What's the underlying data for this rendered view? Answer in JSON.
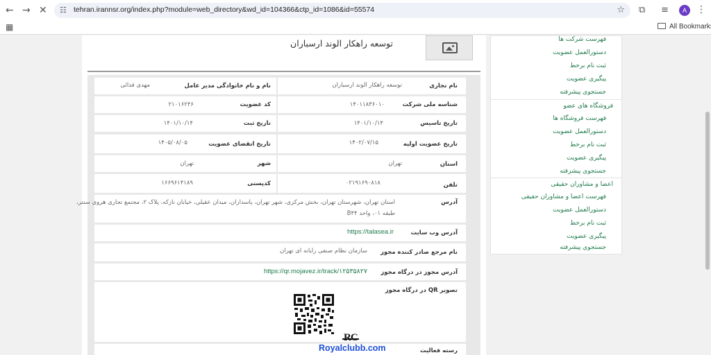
{
  "browser": {
    "url": "tehran.irannsr.org/index.php?module=web_directory&wd_id=104366&ctp_id=1086&id=55574",
    "back_icon": "back-arrow-icon",
    "forward_icon": "forward-arrow-icon",
    "stop_icon": "close-icon",
    "avatar_letter": "A",
    "all_bookmarks": "All Bookmarks"
  },
  "company": {
    "title": "توسعه راهکار الوند ارسباران"
  },
  "details": {
    "trade_name_label": "نام تجاری",
    "trade_name_value": "توسعه راهکار الوند ارسباران",
    "ceo_label": "نام و نام خانوادگی مدیر عامل",
    "ceo_value": "مهدی فدائی",
    "national_id_label": "شناسه ملی شرکت",
    "national_id_value": "۱۴۰۱۱۸۳۶۰۱۰",
    "member_code_label": "کد عضویت",
    "member_code_value": "۲۱۰۱۶۲۴۶",
    "founding_date_label": "تاریخ تاسیس",
    "founding_date_value": "۱۴۰۱/۱۰/۱۴",
    "register_date_label": "تاریخ ثبت",
    "register_date_value": "۱۴۰۱/۱۰/۱۴",
    "first_membership_label": "تاریخ عضویت اولیه",
    "first_membership_value": "۱۴۰۲/۰۷/۱۵",
    "membership_expiry_label": "تاریخ انقضای عضویت",
    "membership_expiry_value": "۱۴۰۵/۰۸/۰۵",
    "province_label": "استان",
    "province_value": "تهران",
    "city_label": "شهر",
    "city_value": "تهران",
    "phone_label": "تلفن",
    "phone_value": "۰۲۱۹۱۶۹۰۸۱۸",
    "postal_code_label": "کدپستی",
    "postal_code_value": "۱۶۶۹۶۱۴۱۸۹",
    "address_label": "آدرس",
    "address_line1": "استان تهران، شهرستان تهران، بخش مرکزی، شهر تهران، پاسداران، میدان عقیلی، خیابان نازکه، پلاک ۲، مجتمع تجاری هروی سنتر،",
    "address_line2": "طبقه ۰۱، واحد B۴۴",
    "website_label": "آدرس وب سایت",
    "website_value": "https://talasea.ir",
    "license_issuer_label": "نام مرجع صادر کننده مجوز",
    "license_issuer_value": "سازمان نظام صنفی رایانه ای تهران",
    "license_url_label": "آدرس مجوز در درگاه مجوز",
    "license_url_value": "https://qr.mojavez.ir/track/۱۲۵۳۵۸۲۷",
    "qr_label": "تصویر QR در درگاه مجوز",
    "activity_label": "رسته فعالیت"
  },
  "sidebar": {
    "items": [
      {
        "label": "فهرست شرکت ها",
        "type": "sub"
      },
      {
        "label": "دستورالعمل عضویت",
        "type": "sub"
      },
      {
        "label": "ثبت نام برخط",
        "type": "sub"
      },
      {
        "label": "پیگیری عضویت",
        "type": "sub"
      },
      {
        "label": "جستجوی پیشرفته",
        "type": "sub"
      },
      {
        "label": "فروشگاه های عضو",
        "type": "section"
      },
      {
        "label": "فهرست فروشگاه ها",
        "type": "sub"
      },
      {
        "label": "دستورالعمل عضویت",
        "type": "sub"
      },
      {
        "label": "ثبت نام برخط",
        "type": "sub"
      },
      {
        "label": "پیگیری عضویت",
        "type": "sub"
      },
      {
        "label": "جستجوی پیشرفته",
        "type": "sub"
      },
      {
        "label": "اعضا و مشاوران حقیقی",
        "type": "section"
      },
      {
        "label": "فهرست اعضا و مشاوران حقیقی",
        "type": "sub"
      },
      {
        "label": "دستورالعمل عضویت",
        "type": "sub"
      },
      {
        "label": "ثبت نام برخط",
        "type": "sub"
      },
      {
        "label": "پیگیری عضویت",
        "type": "sub"
      },
      {
        "label": "جستجوی پیشرفته",
        "type": "sub"
      }
    ]
  },
  "watermark": {
    "logo": "RC",
    "text": "Royalclubb.com"
  },
  "colors": {
    "link_green": "#1e7a4a",
    "watermark_blue": "#1d4ed8"
  }
}
